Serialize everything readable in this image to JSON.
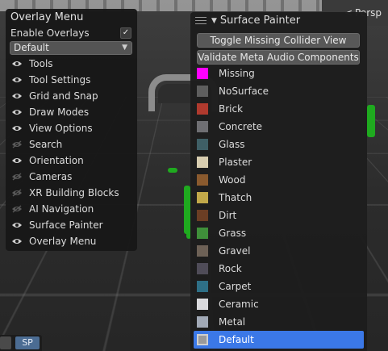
{
  "viewport": {
    "projection_label": "Persp"
  },
  "overlay_menu": {
    "title": "Overlay Menu",
    "enable_overlays_label": "Enable Overlays",
    "enable_overlays_checked": true,
    "preset_value": "Default",
    "items": [
      {
        "label": "Tools",
        "visible": true
      },
      {
        "label": "Tool Settings",
        "visible": true
      },
      {
        "label": "Grid and Snap",
        "visible": true
      },
      {
        "label": "Draw Modes",
        "visible": true
      },
      {
        "label": "View Options",
        "visible": true
      },
      {
        "label": "Search",
        "visible": false
      },
      {
        "label": "Orientation",
        "visible": true
      },
      {
        "label": "Cameras",
        "visible": false
      },
      {
        "label": "XR Building Blocks",
        "visible": false
      },
      {
        "label": "AI Navigation",
        "visible": false
      },
      {
        "label": "Surface Painter",
        "visible": true
      },
      {
        "label": "Overlay Menu",
        "visible": true
      }
    ]
  },
  "surface_painter": {
    "title": "Surface Painter",
    "toggle_button_label": "Toggle Missing Collider View",
    "validate_button_label": "Validate Meta Audio Components",
    "surfaces": [
      {
        "label": "Missing",
        "color": "#ff00ff",
        "selected": false
      },
      {
        "label": "NoSurface",
        "color": "#5e5e5e",
        "selected": false
      },
      {
        "label": "Brick",
        "color": "#b03a2e",
        "selected": false
      },
      {
        "label": "Concrete",
        "color": "#6f6f73",
        "selected": false
      },
      {
        "label": "Glass",
        "color": "#3f5f66",
        "selected": false
      },
      {
        "label": "Plaster",
        "color": "#d8cdb0",
        "selected": false
      },
      {
        "label": "Wood",
        "color": "#8a5a2e",
        "selected": false
      },
      {
        "label": "Thatch",
        "color": "#c2a94a",
        "selected": false
      },
      {
        "label": "Dirt",
        "color": "#6b3e24",
        "selected": false
      },
      {
        "label": "Grass",
        "color": "#3f8f3a",
        "selected": false
      },
      {
        "label": "Gravel",
        "color": "#6d6156",
        "selected": false
      },
      {
        "label": "Rock",
        "color": "#4f4c58",
        "selected": false
      },
      {
        "label": "Carpet",
        "color": "#2e6f86",
        "selected": false
      },
      {
        "label": "Ceramic",
        "color": "#d9d9dc",
        "selected": false
      },
      {
        "label": "Metal",
        "color": "#a1a9b6",
        "selected": false
      },
      {
        "label": "Default",
        "color": "#9a9a9a",
        "selected": true
      }
    ]
  },
  "mini_toolbar": {
    "sp_label": "SP"
  },
  "colors": {
    "selection": "#3b78e7",
    "panel_bg": "#1e1e1e",
    "button_bg": "#585858"
  }
}
